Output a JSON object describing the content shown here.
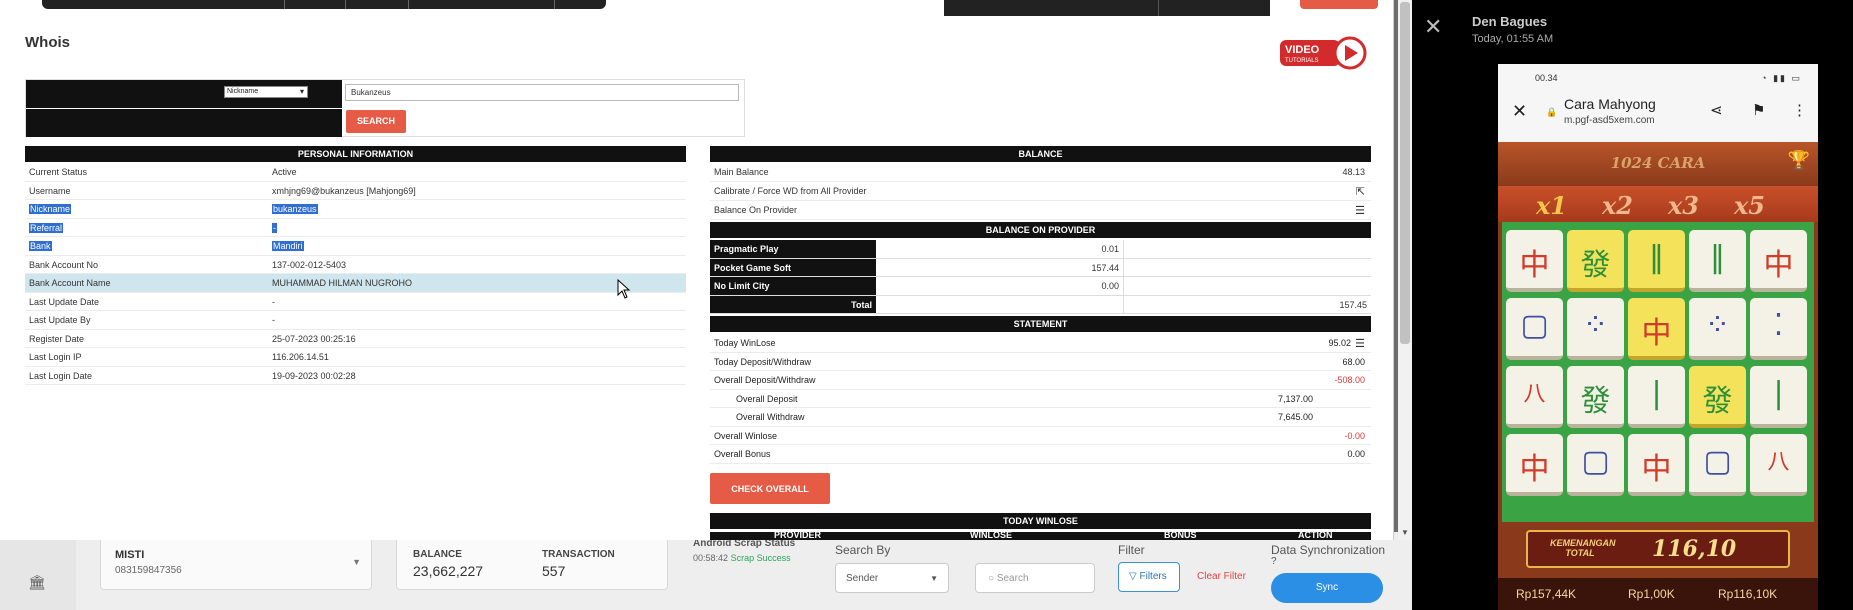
{
  "whois": {
    "title": "Whois",
    "video_logo_text": "VIDEO",
    "video_logo_sub": "TUTORIALS",
    "search": {
      "select_value": "Nickname",
      "input_value": "Bukanzeus",
      "button": "SEARCH"
    },
    "personal": {
      "header": "PERSONAL INFORMATION",
      "rows": [
        {
          "label": "Current Status",
          "value": "Active"
        },
        {
          "label": "Username",
          "value": "xmhjng69@bukanzeus  [Mahjong69]"
        },
        {
          "label": "Nickname",
          "value": "bukanzeus"
        },
        {
          "label": "Referral",
          "value": "-"
        },
        {
          "label": "Bank",
          "value": "Mandiri"
        },
        {
          "label": "Bank Account No",
          "value": "137-002-012-5403"
        },
        {
          "label": "Bank Account Name",
          "value": "MUHAMMAD HILMAN NUGROHO"
        },
        {
          "label": "Last Update Date",
          "value": "-"
        },
        {
          "label": "Last Update By",
          "value": "-"
        },
        {
          "label": "Register Date",
          "value": "25-07-2023 00:25:16"
        },
        {
          "label": "Last Login IP",
          "value": "116.206.14.51"
        },
        {
          "label": "Last Login Date",
          "value": "19-09-2023 00:02:28"
        }
      ]
    },
    "balance": {
      "header": "BALANCE",
      "main_balance_label": "Main Balance",
      "main_balance_value": "48.13",
      "calibrate_label": "Calibrate / Force WD from All Provider",
      "on_provider_label": "Balance On Provider",
      "provider_header": "BALANCE ON PROVIDER",
      "providers": [
        {
          "name": "Pragmatic Play",
          "value": "0.01"
        },
        {
          "name": "Pocket Game Soft",
          "value": "157.44"
        },
        {
          "name": "No Limit City",
          "value": "0.00"
        }
      ],
      "total_label": "Total",
      "total_value": "157.45"
    },
    "statement": {
      "header": "STATEMENT",
      "today_winlose_label": "Today WinLose",
      "today_winlose_value": "95.02",
      "today_dw_label": "Today Deposit/Withdraw",
      "today_dw_value": "68.00",
      "overall_dw_label": "Overall Deposit/Withdraw",
      "overall_dw_value": "-508.00",
      "overall_deposit_label": "Overall Deposit",
      "overall_deposit_value": "7,137.00",
      "overall_withdraw_label": "Overall Withdraw",
      "overall_withdraw_value": "7,645.00",
      "overall_winlose_label": "Overall Winlose",
      "overall_winlose_value": "-0.00",
      "overall_bonus_label": "Overall Bonus",
      "overall_bonus_value": "0.00"
    },
    "check_overall_button": "CHECK OVERALL",
    "today_winlose_header": "TODAY WINLOSE",
    "today_cols": [
      "PROVIDER",
      "WINLOSE",
      "BONUS",
      "ACTION"
    ]
  },
  "background": {
    "account_name": "MISTI",
    "account_phone": "083159847356",
    "balance_label": "BALANCE",
    "balance_value": "23,662,227",
    "transaction_label": "TRANSACTION",
    "transaction_value": "557",
    "scrap_title": "Android Scrap Status",
    "scrap_time": "00:58:42",
    "scrap_status": "Scrap Success",
    "search_by_label": "Search By",
    "search_by_value": "Sender",
    "search_placeholder": "Search",
    "filter_label": "Filter",
    "filters_button": "Filters",
    "clear_filter": "Clear Filter",
    "sync_label": "Data Synchronization",
    "sync_button": "Sync"
  },
  "viewer": {
    "sender": "Den Bagues",
    "time": "Today, 01:55 AM",
    "phone": {
      "status_time": "00.34",
      "page_title": "Cara Mahyong",
      "page_url": "m.pgf-asd5xem.com",
      "game_banner": "1024 CARA",
      "multipliers": [
        "x1",
        "x2",
        "x3",
        "x5"
      ],
      "win_label": "KEMENANGAN TOTAL",
      "win_value": "116,10",
      "balance_bottom": "Rp157,44K",
      "bet_bottom": "Rp1,00K",
      "win_bottom": "Rp116,10K"
    }
  },
  "colors": {
    "accent": "#e55b45",
    "header_black": "#111111",
    "selection": "#2f6fd1",
    "negative": "#e03b3b"
  }
}
